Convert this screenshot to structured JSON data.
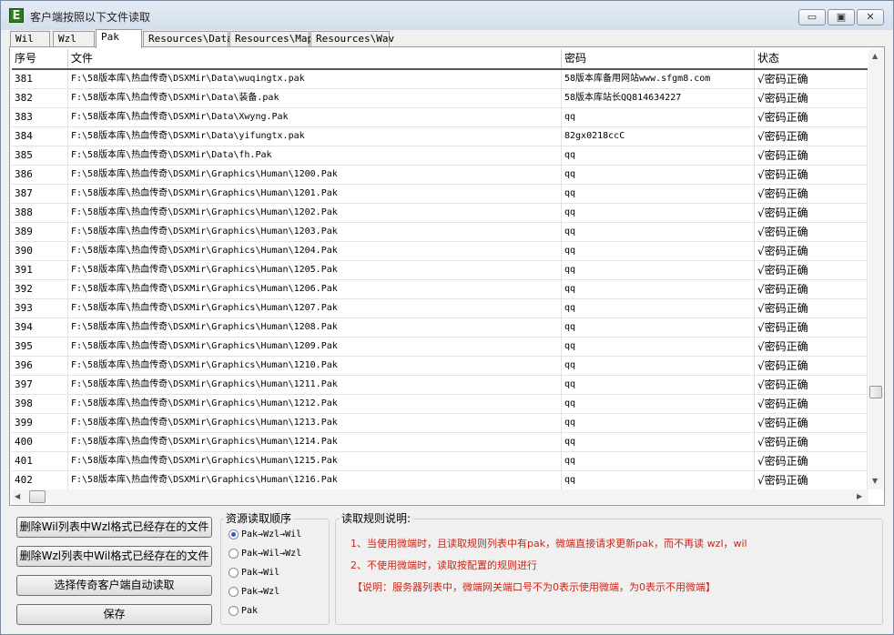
{
  "window": {
    "title": "客户端按照以下文件读取",
    "app_icon_letter": "E",
    "minimize_glyph": "▭",
    "maximize_glyph": "▣",
    "close_glyph": "✕"
  },
  "tabs": [
    {
      "label": "Wil"
    },
    {
      "label": "Wzl"
    },
    {
      "label": "Pak"
    },
    {
      "label": "Resources\\Data"
    },
    {
      "label": "Resources\\Map"
    },
    {
      "label": "Resources\\Wav"
    }
  ],
  "table": {
    "headers": [
      "序号",
      "文件",
      "密码",
      "状态"
    ],
    "rows": [
      {
        "no": "381",
        "file": "F:\\58版本库\\热血传奇\\DSXMir\\Data\\wuqingtx.pak",
        "password": "58版本库备用网站www.sfgm8.com",
        "status": "√密码正确"
      },
      {
        "no": "382",
        "file": "F:\\58版本库\\热血传奇\\DSXMir\\Data\\装备.pak",
        "password": "58版本库站长QQ814634227",
        "status": "√密码正确"
      },
      {
        "no": "383",
        "file": "F:\\58版本库\\热血传奇\\DSXMir\\Data\\Xwyng.Pak",
        "password": "qq",
        "status": "√密码正确"
      },
      {
        "no": "384",
        "file": "F:\\58版本库\\热血传奇\\DSXMir\\Data\\yifungtx.pak",
        "password": "82gx0218ccC",
        "status": "√密码正确"
      },
      {
        "no": "385",
        "file": "F:\\58版本库\\热血传奇\\DSXMir\\Data\\fh.Pak",
        "password": "qq",
        "status": "√密码正确"
      },
      {
        "no": "386",
        "file": "F:\\58版本库\\热血传奇\\DSXMir\\Graphics\\Human\\1200.Pak",
        "password": "qq",
        "status": "√密码正确"
      },
      {
        "no": "387",
        "file": "F:\\58版本库\\热血传奇\\DSXMir\\Graphics\\Human\\1201.Pak",
        "password": "qq",
        "status": "√密码正确"
      },
      {
        "no": "388",
        "file": "F:\\58版本库\\热血传奇\\DSXMir\\Graphics\\Human\\1202.Pak",
        "password": "qq",
        "status": "√密码正确"
      },
      {
        "no": "389",
        "file": "F:\\58版本库\\热血传奇\\DSXMir\\Graphics\\Human\\1203.Pak",
        "password": "qq",
        "status": "√密码正确"
      },
      {
        "no": "390",
        "file": "F:\\58版本库\\热血传奇\\DSXMir\\Graphics\\Human\\1204.Pak",
        "password": "qq",
        "status": "√密码正确"
      },
      {
        "no": "391",
        "file": "F:\\58版本库\\热血传奇\\DSXMir\\Graphics\\Human\\1205.Pak",
        "password": "qq",
        "status": "√密码正确"
      },
      {
        "no": "392",
        "file": "F:\\58版本库\\热血传奇\\DSXMir\\Graphics\\Human\\1206.Pak",
        "password": "qq",
        "status": "√密码正确"
      },
      {
        "no": "393",
        "file": "F:\\58版本库\\热血传奇\\DSXMir\\Graphics\\Human\\1207.Pak",
        "password": "qq",
        "status": "√密码正确"
      },
      {
        "no": "394",
        "file": "F:\\58版本库\\热血传奇\\DSXMir\\Graphics\\Human\\1208.Pak",
        "password": "qq",
        "status": "√密码正确"
      },
      {
        "no": "395",
        "file": "F:\\58版本库\\热血传奇\\DSXMir\\Graphics\\Human\\1209.Pak",
        "password": "qq",
        "status": "√密码正确"
      },
      {
        "no": "396",
        "file": "F:\\58版本库\\热血传奇\\DSXMir\\Graphics\\Human\\1210.Pak",
        "password": "qq",
        "status": "√密码正确"
      },
      {
        "no": "397",
        "file": "F:\\58版本库\\热血传奇\\DSXMir\\Graphics\\Human\\1211.Pak",
        "password": "qq",
        "status": "√密码正确"
      },
      {
        "no": "398",
        "file": "F:\\58版本库\\热血传奇\\DSXMir\\Graphics\\Human\\1212.Pak",
        "password": "qq",
        "status": "√密码正确"
      },
      {
        "no": "399",
        "file": "F:\\58版本库\\热血传奇\\DSXMir\\Graphics\\Human\\1213.Pak",
        "password": "qq",
        "status": "√密码正确"
      },
      {
        "no": "400",
        "file": "F:\\58版本库\\热血传奇\\DSXMir\\Graphics\\Human\\1214.Pak",
        "password": "qq",
        "status": "√密码正确"
      },
      {
        "no": "401",
        "file": "F:\\58版本库\\热血传奇\\DSXMir\\Graphics\\Human\\1215.Pak",
        "password": "qq",
        "status": "√密码正确"
      },
      {
        "no": "402",
        "file": "F:\\58版本库\\热血传奇\\DSXMir\\Graphics\\Human\\1216.Pak",
        "password": "qq",
        "status": "√密码正确"
      }
    ]
  },
  "scrollbar": {
    "up_glyph": "▲",
    "down_glyph": "▼",
    "left_glyph": "◀",
    "right_glyph": "▶"
  },
  "buttons": {
    "delete_wil": "删除Wil列表中Wzl格式已经存在的文件",
    "delete_wzl": "删除Wzl列表中Wil格式已经存在的文件",
    "select_client": "选择传奇客户端自动读取",
    "save": "保存"
  },
  "read_order": {
    "title": "资源读取顺序",
    "selected_index": 0,
    "options": [
      "Pak→Wzl→Wil",
      "Pak→Wil→Wzl",
      "Pak→Wil",
      "Pak→Wzl",
      "Pak"
    ]
  },
  "rules": {
    "title": "读取规则说明:",
    "line1": "1、当使用微端时，且读取规则列表中有pak，微端直接请求更新pak，而不再读 wzl，wil",
    "line2": "2、不使用微端时，读取按配置的规则进行",
    "line3": "【说明：服务器列表中，微端网关端口号不为0表示使用微端，为0表示不用微端】"
  },
  "colors": {
    "rule_text": "#c8281a",
    "radio_selected": "#2a5bd0",
    "app_icon": "#2e7a1e"
  }
}
